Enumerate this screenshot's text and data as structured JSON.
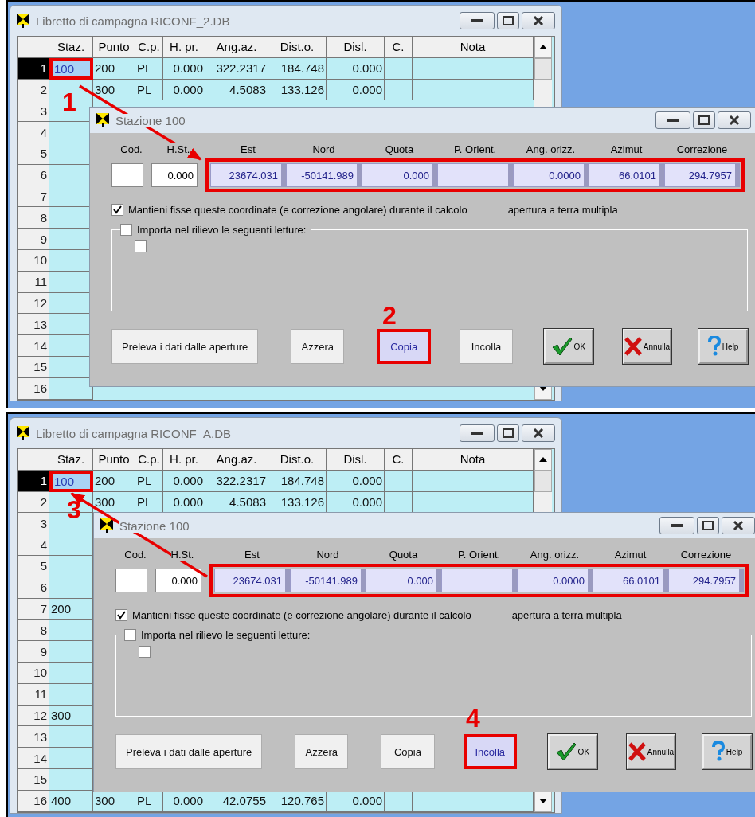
{
  "panels": [
    {
      "window": {
        "title": "Libretto di campagna RICONF_2.DB"
      },
      "table": {
        "columns": [
          "Staz.",
          "Punto",
          "C.p.",
          "H. pr.",
          "Ang.az.",
          "Dist.o.",
          "Disl.",
          "C.",
          "Nota"
        ],
        "rows": [
          {
            "number": "1",
            "selected": true,
            "outlined": true,
            "cells": [
              "100",
              "200",
              "PL",
              "0.000",
              "322.2317",
              "184.748",
              "0.000",
              null,
              null
            ]
          },
          {
            "number": "2",
            "selected": false,
            "outlined": false,
            "cells": [
              null,
              "300",
              "PL",
              "0.000",
              "4.5083",
              "133.126",
              "0.000",
              null,
              null
            ]
          },
          {
            "number": "3",
            "selected": false,
            "outlined": false,
            "cells": [
              null
            ]
          },
          {
            "number": "4",
            "selected": false,
            "outlined": false,
            "cells": [
              null
            ]
          },
          {
            "number": "5",
            "selected": false,
            "outlined": false,
            "cells": [
              null
            ]
          },
          {
            "number": "6",
            "selected": false,
            "outlined": false,
            "cells": [
              null
            ]
          },
          {
            "number": "7",
            "selected": false,
            "outlined": false,
            "cells": [
              null
            ]
          },
          {
            "number": "8",
            "selected": false,
            "outlined": false,
            "cells": [
              null
            ]
          },
          {
            "number": "9",
            "selected": false,
            "outlined": false,
            "cells": [
              null
            ]
          },
          {
            "number": "10",
            "selected": false,
            "outlined": false,
            "cells": [
              null
            ]
          },
          {
            "number": "11",
            "selected": false,
            "outlined": false,
            "cells": [
              null
            ]
          },
          {
            "number": "12",
            "selected": false,
            "outlined": false,
            "cells": [
              null
            ]
          },
          {
            "number": "13",
            "selected": false,
            "outlined": false,
            "cells": [
              null
            ]
          },
          {
            "number": "14",
            "selected": false,
            "outlined": false,
            "cells": [
              null
            ]
          },
          {
            "number": "15",
            "selected": false,
            "outlined": false,
            "cells": [
              null
            ]
          },
          {
            "number": "16",
            "selected": false,
            "outlined": false,
            "cells": [
              null
            ]
          }
        ]
      },
      "dialog": {
        "title": "Stazione 100",
        "fields_outlined": true,
        "fields": [
          {
            "kind": "plain",
            "label": "Cod."
          },
          {
            "kind": "plain",
            "label": "H.St.",
            "value": "0.000"
          },
          {
            "kind": "coord",
            "label": "Est",
            "value": "23674.031"
          },
          {
            "kind": "coord",
            "label": "Nord",
            "value": "-50141.989"
          },
          {
            "kind": "coord",
            "label": "Quota",
            "value": "0.000"
          },
          {
            "kind": "coord",
            "label": "P. Orient."
          },
          {
            "kind": "coord",
            "label": "Ang. orizz.",
            "value": "0.0000"
          },
          {
            "kind": "coord",
            "label": "Azimut",
            "value": "66.0101"
          },
          {
            "kind": "coord",
            "label": "Correzione",
            "value": "294.7957"
          }
        ],
        "fix_checkbox": {
          "label": "Mantieni fisse queste coordinate (e correzione angolare) durante il calcolo",
          "checked": true
        },
        "note": "apertura a terra multipla",
        "import_group": {
          "label": "Importa nel rilievo le seguenti letture:",
          "checked": false,
          "inner_checked": false
        },
        "buttons": [
          {
            "kind": "text",
            "label": "Preleva i dati dalle aperture",
            "focused": false,
            "outlined": false
          },
          {
            "kind": "text",
            "label": "Azzera",
            "focused": false,
            "outlined": false
          },
          {
            "kind": "text",
            "label": "Copia",
            "focused": true,
            "outlined": true
          },
          {
            "kind": "text",
            "label": "Incolla",
            "focused": false,
            "outlined": false
          },
          {
            "kind": "ok",
            "label": "OK",
            "focused": false,
            "outlined": false
          },
          {
            "kind": "cancel",
            "label": "Annulla",
            "focused": false,
            "outlined": false
          },
          {
            "kind": "help",
            "label": "Help",
            "focused": false,
            "outlined": false
          }
        ]
      },
      "annotations": {
        "cell_marker": "1",
        "button_marker": "2",
        "arrow_to_cell": false
      }
    },
    {
      "window": {
        "title": "Libretto di campagna RICONF_A.DB"
      },
      "table": {
        "columns": [
          "Staz.",
          "Punto",
          "C.p.",
          "H. pr.",
          "Ang.az.",
          "Dist.o.",
          "Disl.",
          "C.",
          "Nota"
        ],
        "rows": [
          {
            "number": "1",
            "selected": true,
            "outlined": true,
            "cells": [
              "100",
              "200",
              "PL",
              "0.000",
              "322.2317",
              "184.748",
              "0.000",
              null,
              null
            ]
          },
          {
            "number": "2",
            "selected": false,
            "outlined": false,
            "cells": [
              null,
              "300",
              "PL",
              "0.000",
              "4.5083",
              "133.126",
              "0.000",
              null,
              null
            ]
          },
          {
            "number": "3",
            "selected": false,
            "outlined": false,
            "cells": [
              null
            ]
          },
          {
            "number": "4",
            "selected": false,
            "outlined": false,
            "cells": [
              null
            ]
          },
          {
            "number": "5",
            "selected": false,
            "outlined": false,
            "cells": [
              null
            ]
          },
          {
            "number": "6",
            "selected": false,
            "outlined": false,
            "cells": [
              null
            ]
          },
          {
            "number": "7",
            "selected": false,
            "outlined": false,
            "cells": [
              "200"
            ]
          },
          {
            "number": "8",
            "selected": false,
            "outlined": false,
            "cells": [
              null
            ]
          },
          {
            "number": "9",
            "selected": false,
            "outlined": false,
            "cells": [
              null
            ]
          },
          {
            "number": "10",
            "selected": false,
            "outlined": false,
            "cells": [
              null
            ]
          },
          {
            "number": "11",
            "selected": false,
            "outlined": false,
            "cells": [
              null
            ]
          },
          {
            "number": "12",
            "selected": false,
            "outlined": false,
            "cells": [
              "300"
            ]
          },
          {
            "number": "13",
            "selected": false,
            "outlined": false,
            "cells": [
              null
            ]
          },
          {
            "number": "14",
            "selected": false,
            "outlined": false,
            "cells": [
              null
            ]
          },
          {
            "number": "15",
            "selected": false,
            "outlined": false,
            "cells": [
              null
            ]
          },
          {
            "number": "16",
            "selected": false,
            "outlined": false,
            "cells": [
              "400",
              "300",
              "PL",
              "0.000",
              "42.0755",
              "120.765",
              "0.000",
              null,
              null
            ]
          }
        ]
      },
      "dialog": {
        "title": "Stazione 100",
        "fields_outlined": true,
        "fields": [
          {
            "kind": "plain",
            "label": "Cod."
          },
          {
            "kind": "plain",
            "label": "H.St.",
            "value": "0.000"
          },
          {
            "kind": "coord",
            "label": "Est",
            "value": "23674.031"
          },
          {
            "kind": "coord",
            "label": "Nord",
            "value": "-50141.989"
          },
          {
            "kind": "coord",
            "label": "Quota",
            "value": "0.000"
          },
          {
            "kind": "coord",
            "label": "P. Orient."
          },
          {
            "kind": "coord",
            "label": "Ang. orizz.",
            "value": "0.0000"
          },
          {
            "kind": "coord",
            "label": "Azimut",
            "value": "66.0101"
          },
          {
            "kind": "coord",
            "label": "Correzione",
            "value": "294.7957"
          }
        ],
        "fix_checkbox": {
          "label": "Mantieni fisse queste coordinate (e correzione angolare) durante il calcolo",
          "checked": true
        },
        "note": "apertura a terra multipla",
        "import_group": {
          "label": "Importa nel rilievo le seguenti letture:",
          "checked": false,
          "inner_checked": false
        },
        "buttons": [
          {
            "kind": "text",
            "label": "Preleva i dati dalle aperture",
            "focused": false,
            "outlined": false
          },
          {
            "kind": "text",
            "label": "Azzera",
            "focused": false,
            "outlined": false
          },
          {
            "kind": "text",
            "label": "Copia",
            "focused": false,
            "outlined": false
          },
          {
            "kind": "text",
            "label": "Incolla",
            "focused": true,
            "outlined": true
          },
          {
            "kind": "ok",
            "label": "OK",
            "focused": false,
            "outlined": false
          },
          {
            "kind": "cancel",
            "label": "Annulla",
            "focused": false,
            "outlined": false
          },
          {
            "kind": "help",
            "label": "Help",
            "focused": false,
            "outlined": false
          }
        ]
      },
      "annotations": {
        "cell_marker": "3",
        "button_marker": "4",
        "arrow_to_cell": true
      }
    }
  ]
}
